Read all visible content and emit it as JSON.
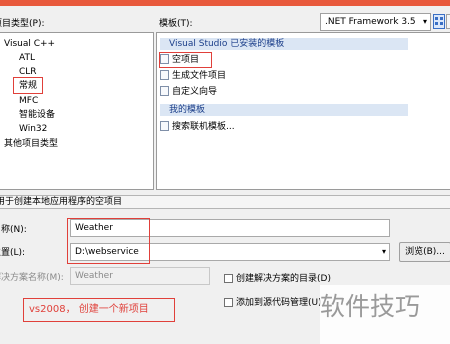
{
  "project_types": {
    "label": "项目类型(P):",
    "items": [
      "Visual C++",
      "ATL",
      "CLR",
      "常规",
      "MFC",
      "智能设备",
      "Win32",
      "其他项目类型"
    ]
  },
  "templates": {
    "label": "模板(T):",
    "framework": ".NET Framework 3.5",
    "group_installed": "Visual Studio 已安装的模板",
    "installed_items": [
      "空项目",
      "生成文件项目",
      "自定义向导"
    ],
    "group_mine": "我的模板",
    "my_items": [
      "搜索联机模板..."
    ]
  },
  "description": "用于创建本地应用程序的空项目",
  "form": {
    "name_label": "名称(N):",
    "name_value": "Weather",
    "location_label": "位置(L):",
    "location_value": "D:\\webservice",
    "browse_label": "浏览(B)...",
    "solution_label": "解决方案名称(M):",
    "solution_value": "Weather",
    "create_dir_label": "创建解决方案的目录(D)",
    "add_source_label": "添加到源代码管理(U)"
  },
  "annotation": "vs2008， 创建一个新项目",
  "watermark": "软件技巧"
}
